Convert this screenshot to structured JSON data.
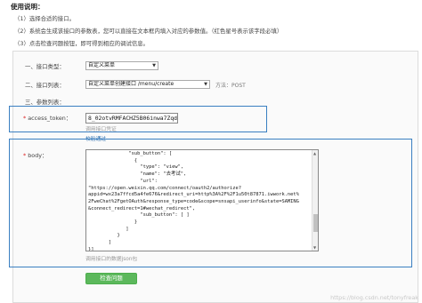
{
  "instructions": {
    "title": "使用说明：",
    "lines": [
      "（1）选择合适的接口。",
      "（2）系统会生成该接口的参数表，您可以直接在文本框内填入对应的参数值。（红色星号表示该字段必填）",
      "（3）点击检查问题按钮，即可得到相应的调试信息。"
    ]
  },
  "form": {
    "interface_type": {
      "label": "一、接口类型：",
      "value": "自定义菜单"
    },
    "interface_list": {
      "label": "二、接口列表：",
      "value": "自定义菜单创建接口 /menu/create",
      "method": "方法：POST"
    },
    "params_label": "三、参数列表：",
    "access_token": {
      "asterisk": "*",
      "label": " access_token：",
      "value": "8_02otvRMFACHZ5B06inwa7Zqd",
      "hint": "调用接口凭证",
      "validate": "校验通过"
    },
    "body": {
      "asterisk": "*",
      "label": " body：",
      "text": "              \"sub_button\": [\n                {\n                  \"type\": \"view\",\n                  \"name\": \"去考试\",\n                  \"url\":\n\"https://open.weixin.qq.com/connect/oauth2/authorize?\nappid=wx23a7ffcd5a4fe676&redirect_uri=http%3A%2F%2F1u50t87871.iwwork.net%\n2FweChat%2FgetOAuth&response_type=code&scope=snsapi_userinfo&state=SAMING\n&connect_redirect=1#wechat_redirect\",\n                  \"sub_button\": [ ]\n                }\n             ]\n          }\n       ]\n}]",
      "hint": "调用接口的数据json包"
    },
    "check_button": "检查问题"
  },
  "watermark": "https://blog.csdn.net/tonyfreak",
  "colors": {
    "highlight_border": "#3a7fc1",
    "button_green": "#5cb85c",
    "required_red": "#dd2222",
    "link_blue": "#2a6fb0"
  }
}
